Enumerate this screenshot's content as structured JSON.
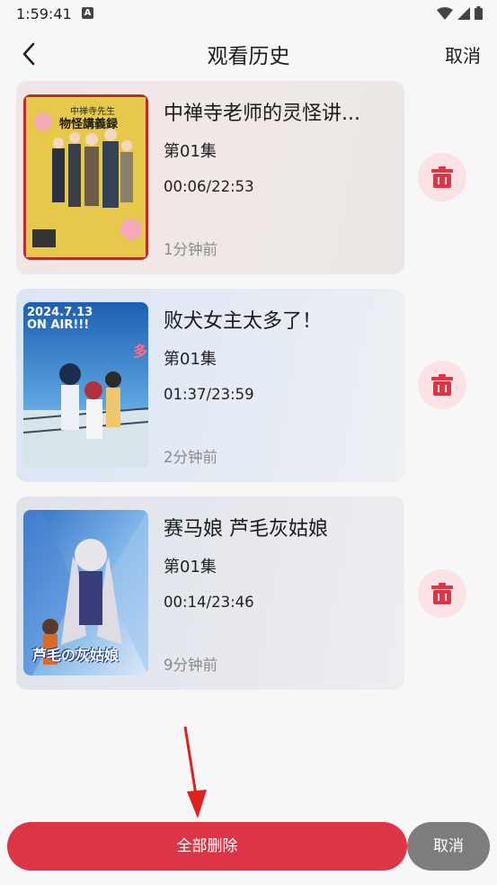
{
  "status_bar": {
    "time": "1:59:41",
    "notif_icon": "A"
  },
  "header": {
    "title": "观看历史",
    "cancel_label": "取消"
  },
  "history": [
    {
      "title": "中禅寺老师的灵怪讲...",
      "episode": "第01集",
      "progress": "00:06/22:53",
      "time_ago": "1分钟前"
    },
    {
      "title": "败犬女主太多了！",
      "episode": "第01集",
      "progress": "01:37/23:59",
      "time_ago": "2分钟前"
    },
    {
      "title": "赛马娘 芦毛灰姑娘",
      "episode": "第01集",
      "progress": "00:14/23:46",
      "time_ago": "9分钟前"
    }
  ],
  "posters": {
    "p1": {
      "caption_a": "中禅寺先生",
      "caption_b": "物怪講義録"
    },
    "p2": {
      "caption_a": "2024.7.13",
      "caption_b": "ON AIR!!!"
    },
    "p3": {
      "caption_a": "芦毛の灰姑娘"
    }
  },
  "footer": {
    "delete_all_label": "全部删除",
    "cancel_label": "取消"
  },
  "colors": {
    "accent": "#dc3546",
    "delete_bg": "#fbe3e5",
    "secondary_btn": "#7d7d7d"
  }
}
